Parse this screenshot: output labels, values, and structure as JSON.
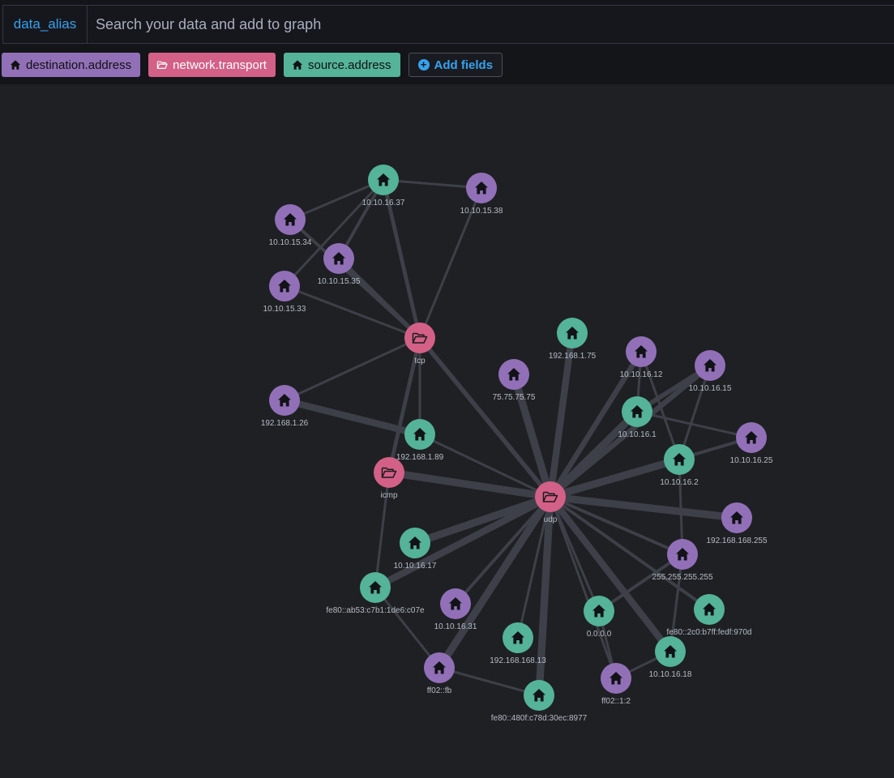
{
  "search": {
    "index_label": "data_alias",
    "placeholder": "Search your data and add to graph"
  },
  "fields": [
    {
      "label": "destination.address",
      "color": "#9170b8",
      "icon": "home-icon",
      "text_style": "dark"
    },
    {
      "label": "network.transport",
      "color": "#d36086",
      "icon": "folder-open-icon",
      "text_style": "light"
    },
    {
      "label": "source.address",
      "color": "#54b399",
      "icon": "home-icon",
      "text_style": "dark"
    }
  ],
  "add_fields_label": "Add fields",
  "colors": {
    "destination.address": "#9170b8",
    "network.transport": "#d36086",
    "source.address": "#54b399",
    "edge": "#3d4048",
    "accent": "#36a2ef"
  },
  "graph": {
    "nodes": [
      {
        "id": "10.10.16.37",
        "label": "10.10.16.37",
        "field": "source.address"
      },
      {
        "id": "10.10.15.38",
        "label": "10.10.15.38",
        "field": "destination.address"
      },
      {
        "id": "10.10.15.34",
        "label": "10.10.15.34",
        "field": "destination.address"
      },
      {
        "id": "10.10.15.35",
        "label": "10.10.15.35",
        "field": "destination.address"
      },
      {
        "id": "10.10.15.33",
        "label": "10.10.15.33",
        "field": "destination.address"
      },
      {
        "id": "tcp",
        "label": "tcp",
        "field": "network.transport"
      },
      {
        "id": "192.168.1.75",
        "label": "192.168.1.75",
        "field": "source.address"
      },
      {
        "id": "10.10.16.12",
        "label": "10.10.16.12",
        "field": "destination.address"
      },
      {
        "id": "10.10.16.15",
        "label": "10.10.16.15",
        "field": "destination.address"
      },
      {
        "id": "75.75.75.75",
        "label": "75.75.75.75",
        "field": "destination.address"
      },
      {
        "id": "192.168.1.26",
        "label": "192.168.1.26",
        "field": "destination.address"
      },
      {
        "id": "10.10.16.1",
        "label": "10.10.16.1",
        "field": "source.address"
      },
      {
        "id": "10.10.16.25",
        "label": "10.10.16.25",
        "field": "destination.address"
      },
      {
        "id": "192.168.1.89",
        "label": "192.168.1.89",
        "field": "source.address"
      },
      {
        "id": "10.10.16.2",
        "label": "10.10.16.2",
        "field": "source.address"
      },
      {
        "id": "icmp",
        "label": "icmp",
        "field": "network.transport"
      },
      {
        "id": "udp",
        "label": "udp",
        "field": "network.transport"
      },
      {
        "id": "192.168.168.255",
        "label": "192.168.168.255",
        "field": "destination.address"
      },
      {
        "id": "10.10.16.17",
        "label": "10.10.16.17",
        "field": "source.address"
      },
      {
        "id": "255.255.255.255",
        "label": "255.255.255.255",
        "field": "destination.address"
      },
      {
        "id": "fe80::ab53:c7b1:1de6:c07e",
        "label": "fe80::ab53:c7b1:1de6:c07e",
        "field": "source.address"
      },
      {
        "id": "10.10.16.31",
        "label": "10.10.16.31",
        "field": "destination.address"
      },
      {
        "id": "0.0.0.0",
        "label": "0.0.0.0",
        "field": "source.address"
      },
      {
        "id": "fe80::2c0:b7ff:fedf:970d",
        "label": "fe80::2c0:b7ff:fedf:970d",
        "field": "source.address"
      },
      {
        "id": "192.168.168.13",
        "label": "192.168.168.13",
        "field": "source.address"
      },
      {
        "id": "10.10.16.18",
        "label": "10.10.16.18",
        "field": "source.address"
      },
      {
        "id": "ff02::fb",
        "label": "ff02::fb",
        "field": "destination.address"
      },
      {
        "id": "ff02::1:2",
        "label": "ff02::1:2",
        "field": "destination.address"
      },
      {
        "id": "fe80::480f:c78d:30ec:8977",
        "label": "fe80::480f:c78d:30ec:8977",
        "field": "source.address"
      }
    ],
    "edges": [
      {
        "from": "10.10.16.37",
        "to": "10.10.15.38",
        "weight": 2
      },
      {
        "from": "10.10.16.37",
        "to": "10.10.15.34",
        "weight": 2
      },
      {
        "from": "10.10.16.37",
        "to": "10.10.15.35",
        "weight": 3
      },
      {
        "from": "10.10.16.37",
        "to": "10.10.15.33",
        "weight": 2
      },
      {
        "from": "10.10.16.37",
        "to": "tcp",
        "weight": 4
      },
      {
        "from": "10.10.15.34",
        "to": "tcp",
        "weight": 3
      },
      {
        "from": "10.10.15.35",
        "to": "tcp",
        "weight": 5
      },
      {
        "from": "10.10.15.33",
        "to": "tcp",
        "weight": 2
      },
      {
        "from": "10.10.15.38",
        "to": "tcp",
        "weight": 2
      },
      {
        "from": "192.168.1.26",
        "to": "tcp",
        "weight": 2
      },
      {
        "from": "tcp",
        "to": "192.168.1.89",
        "weight": 2
      },
      {
        "from": "tcp",
        "to": "icmp",
        "weight": 4
      },
      {
        "from": "tcp",
        "to": "udp",
        "weight": 5
      },
      {
        "from": "192.168.1.26",
        "to": "192.168.1.89",
        "weight": 8
      },
      {
        "from": "192.168.1.89",
        "to": "udp",
        "weight": 2
      },
      {
        "from": "icmp",
        "to": "udp",
        "weight": 9
      },
      {
        "from": "icmp",
        "to": "fe80::ab53:c7b1:1de6:c07e",
        "weight": 2
      },
      {
        "from": "udp",
        "to": "192.168.1.75",
        "weight": 8
      },
      {
        "from": "udp",
        "to": "75.75.75.75",
        "weight": 9
      },
      {
        "from": "udp",
        "to": "10.10.16.12",
        "weight": 6
      },
      {
        "from": "udp",
        "to": "10.10.16.15",
        "weight": 6
      },
      {
        "from": "udp",
        "to": "10.10.16.1",
        "weight": 9
      },
      {
        "from": "udp",
        "to": "10.10.16.2",
        "weight": 9
      },
      {
        "from": "udp",
        "to": "10.10.16.25",
        "weight": 3
      },
      {
        "from": "udp",
        "to": "192.168.168.255",
        "weight": 9
      },
      {
        "from": "udp",
        "to": "255.255.255.255",
        "weight": 3
      },
      {
        "from": "udp",
        "to": "10.10.16.17",
        "weight": 9
      },
      {
        "from": "udp",
        "to": "fe80::ab53:c7b1:1de6:c07e",
        "weight": 8
      },
      {
        "from": "udp",
        "to": "10.10.16.31",
        "weight": 3
      },
      {
        "from": "udp",
        "to": "192.168.168.13",
        "weight": 2
      },
      {
        "from": "udp",
        "to": "0.0.0.0",
        "weight": 2
      },
      {
        "from": "udp",
        "to": "fe80::2c0:b7ff:fedf:970d",
        "weight": 3
      },
      {
        "from": "udp",
        "to": "10.10.16.18",
        "weight": 8
      },
      {
        "from": "udp",
        "to": "ff02::fb",
        "weight": 9
      },
      {
        "from": "udp",
        "to": "ff02::1:2",
        "weight": 2
      },
      {
        "from": "udp",
        "to": "fe80::480f:c78d:30ec:8977",
        "weight": 9
      },
      {
        "from": "10.10.16.1",
        "to": "10.10.16.12",
        "weight": 2
      },
      {
        "from": "10.10.16.1",
        "to": "10.10.16.15",
        "weight": 5
      },
      {
        "from": "10.10.16.1",
        "to": "10.10.16.25",
        "weight": 2
      },
      {
        "from": "10.10.16.2",
        "to": "10.10.16.12",
        "weight": 2
      },
      {
        "from": "10.10.16.2",
        "to": "10.10.16.15",
        "weight": 2
      },
      {
        "from": "10.10.16.2",
        "to": "10.10.16.25",
        "weight": 2
      },
      {
        "from": "10.10.16.2",
        "to": "255.255.255.255",
        "weight": 2
      },
      {
        "from": "255.255.255.255",
        "to": "0.0.0.0",
        "weight": 3
      },
      {
        "from": "255.255.255.255",
        "to": "10.10.16.18",
        "weight": 2
      },
      {
        "from": "0.0.0.0",
        "to": "ff02::1:2",
        "weight": 2
      },
      {
        "from": "10.10.16.18",
        "to": "ff02::1:2",
        "weight": 2
      },
      {
        "from": "fe80::ab53:c7b1:1de6:c07e",
        "to": "ff02::fb",
        "weight": 2
      },
      {
        "from": "ff02::fb",
        "to": "fe80::480f:c78d:30ec:8977",
        "weight": 2
      }
    ]
  }
}
